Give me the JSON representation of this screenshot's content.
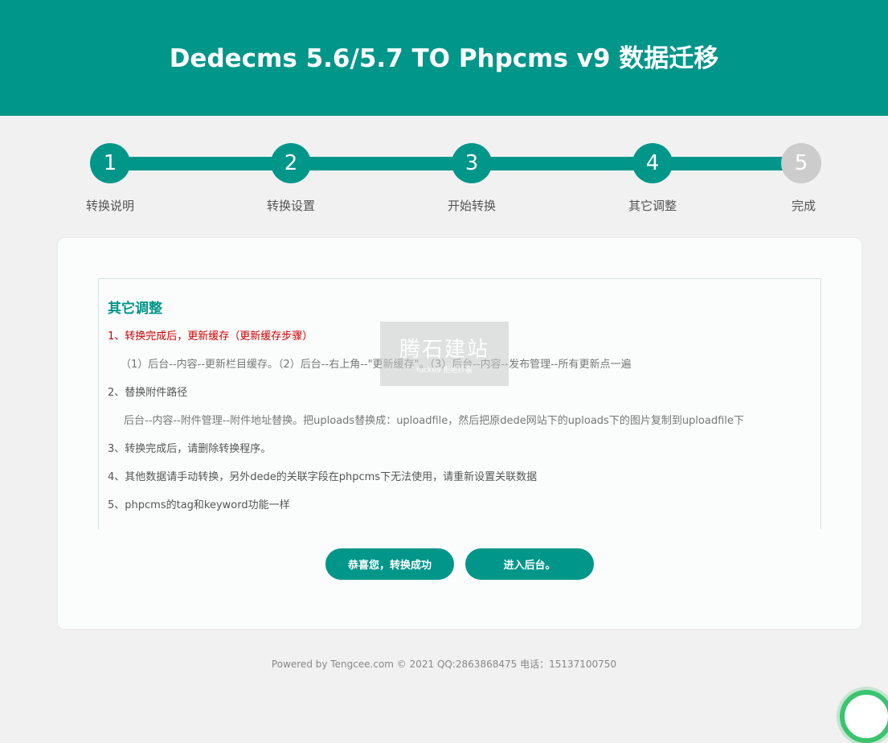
{
  "header": {
    "title": "Dedecms 5.6/5.7 TO Phpcms v9 数据迁移"
  },
  "steps": [
    {
      "number": "1",
      "label": "转换说明",
      "done": true
    },
    {
      "number": "2",
      "label": "转换设置",
      "done": true
    },
    {
      "number": "3",
      "label": "开始转换",
      "done": true
    },
    {
      "number": "4",
      "label": "其它调整",
      "done": true
    },
    {
      "number": "5",
      "label": "完成",
      "done": false
    }
  ],
  "content": {
    "title": "其它调整",
    "lines": [
      "1、转换完成后，更新缓存（更新缓存步骤）",
      "（1）后台--内容--更新栏目缓存。（2）后台--右上角--\"更新缓存\"。（3）后台--内容--发布管理--所有更新点一遍",
      "2、替换附件路径",
      "后台--内容--附件管理--附件地址替换。把uploads替换成：uploadfile，然后把原dede网站下的uploads下的图片复制到uploadfile下",
      "3、转换完成后，请删除转换程序。",
      "4、其他数据请手动转换，另外dede的关联字段在phpcms下无法使用，请重新设置关联数据",
      "5、phpcms的tag和keyword功能一样"
    ]
  },
  "watermark": {
    "main": "腾石建站",
    "sub": "fuck69 拒绝抄袭"
  },
  "buttons": {
    "success": "恭喜您，转换成功",
    "admin": "进入后台。"
  },
  "footer": {
    "text": "Powered by Tengcee.com © 2021 QQ:2863868475 电话：15137100750"
  },
  "colors": {
    "accent": "#00968a",
    "pending": "#cccccc",
    "warning": "#cc0000"
  }
}
